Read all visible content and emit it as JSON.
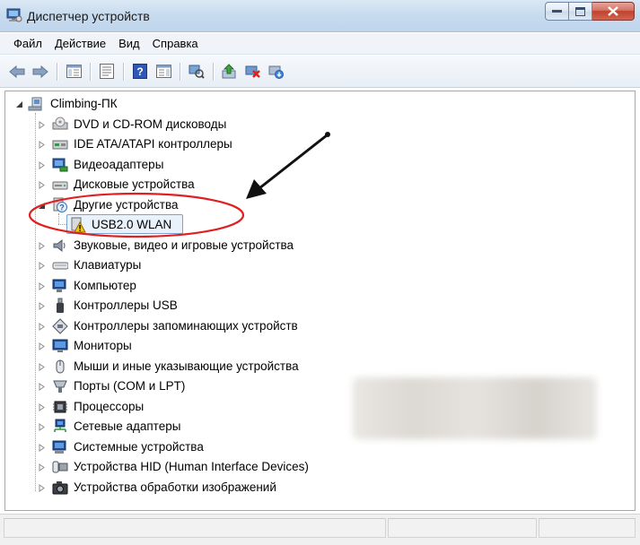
{
  "window": {
    "title": "Диспетчер устройств",
    "icon": "device-manager-icon"
  },
  "menu": {
    "items": [
      "Файл",
      "Действие",
      "Вид",
      "Справка"
    ]
  },
  "toolbar": {
    "buttons": [
      "back-arrow-icon",
      "forward-arrow-icon",
      "show-hide-tree-icon",
      "properties-icon",
      "help-icon",
      "action-pane-icon",
      "scan-hardware-icon",
      "update-driver-icon",
      "disable-device-icon",
      "uninstall-device-icon"
    ]
  },
  "tree": {
    "root": "Climbing-ПК",
    "categories": [
      {
        "label": "DVD и CD-ROM дисководы",
        "icon": "optical-drive-icon"
      },
      {
        "label": "IDE ATA/ATAPI контроллеры",
        "icon": "ide-controller-icon"
      },
      {
        "label": "Видеоадаптеры",
        "icon": "display-adapter-icon"
      },
      {
        "label": "Дисковые устройства",
        "icon": "disk-drive-icon"
      },
      {
        "label": "Другие устройства",
        "icon": "unknown-device-icon",
        "expanded": true
      },
      {
        "label": "USB2.0 WLAN",
        "icon": "warning-device-icon",
        "child": true,
        "selected": true
      },
      {
        "label": "Звуковые, видео и игровые устройства",
        "icon": "sound-icon"
      },
      {
        "label": "Клавиатуры",
        "icon": "keyboard-icon"
      },
      {
        "label": "Компьютер",
        "icon": "computer-icon"
      },
      {
        "label": "Контроллеры USB",
        "icon": "usb-icon"
      },
      {
        "label": "Контроллеры запоминающих устройств",
        "icon": "storage-controller-icon"
      },
      {
        "label": "Мониторы",
        "icon": "monitor-icon"
      },
      {
        "label": "Мыши и иные указывающие устройства",
        "icon": "mouse-icon"
      },
      {
        "label": "Порты (COM и LPT)",
        "icon": "port-icon"
      },
      {
        "label": "Процессоры",
        "icon": "processor-icon"
      },
      {
        "label": "Сетевые адаптеры",
        "icon": "network-adapter-icon"
      },
      {
        "label": "Системные устройства",
        "icon": "system-device-icon"
      },
      {
        "label": "Устройства HID (Human Interface Devices)",
        "icon": "hid-icon"
      },
      {
        "label": "Устройства обработки изображений",
        "icon": "imaging-device-icon"
      }
    ]
  },
  "annotation": {
    "arrow": "arrow-annotation",
    "highlight": "red-ellipse-highlight",
    "accent_color": "#e02020"
  }
}
